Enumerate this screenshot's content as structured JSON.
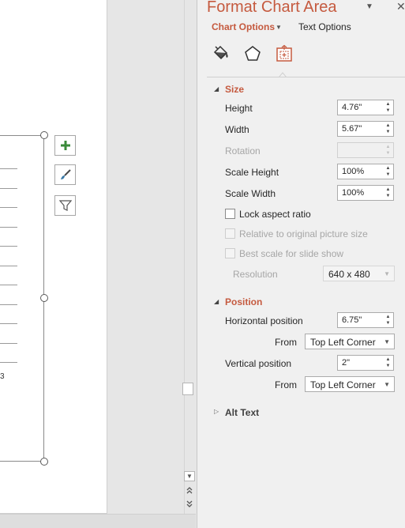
{
  "pane": {
    "title": "Format Chart Area",
    "tabs": {
      "chart_options": "Chart Options",
      "text_options": "Text Options"
    },
    "icons": [
      "fill-line-icon",
      "effects-icon",
      "size-properties-icon"
    ]
  },
  "size": {
    "title": "Size",
    "height_label": "Height",
    "height_value": "4.76\"",
    "width_label": "Width",
    "width_value": "5.67\"",
    "rotation_label": "Rotation",
    "rotation_value": "",
    "scale_height_label": "Scale Height",
    "scale_height_value": "100%",
    "scale_width_label": "Scale Width",
    "scale_width_value": "100%",
    "lock_aspect_label": "Lock aspect ratio",
    "relative_label": "Relative to original picture size",
    "best_scale_label": "Best scale for slide show",
    "resolution_label": "Resolution",
    "resolution_value": "640 x 480"
  },
  "position": {
    "title": "Position",
    "horizontal_label": "Horizontal position",
    "horizontal_value": "6.75\"",
    "from_label": "From",
    "horizontal_from": "Top Left Corner",
    "vertical_label": "Vertical position",
    "vertical_value": "2\"",
    "vertical_from": "Top Left Corner"
  },
  "alt_text": {
    "title": "Alt Text"
  },
  "slide": {
    "axis_tail": "3",
    "chart_buttons": [
      "chart-elements-button",
      "chart-styles-button",
      "chart-filters-button"
    ]
  },
  "colors": {
    "accent": "#c55a3f",
    "pane_bg": "#f0f0f0",
    "chart_plus": "#3a8a3a"
  }
}
